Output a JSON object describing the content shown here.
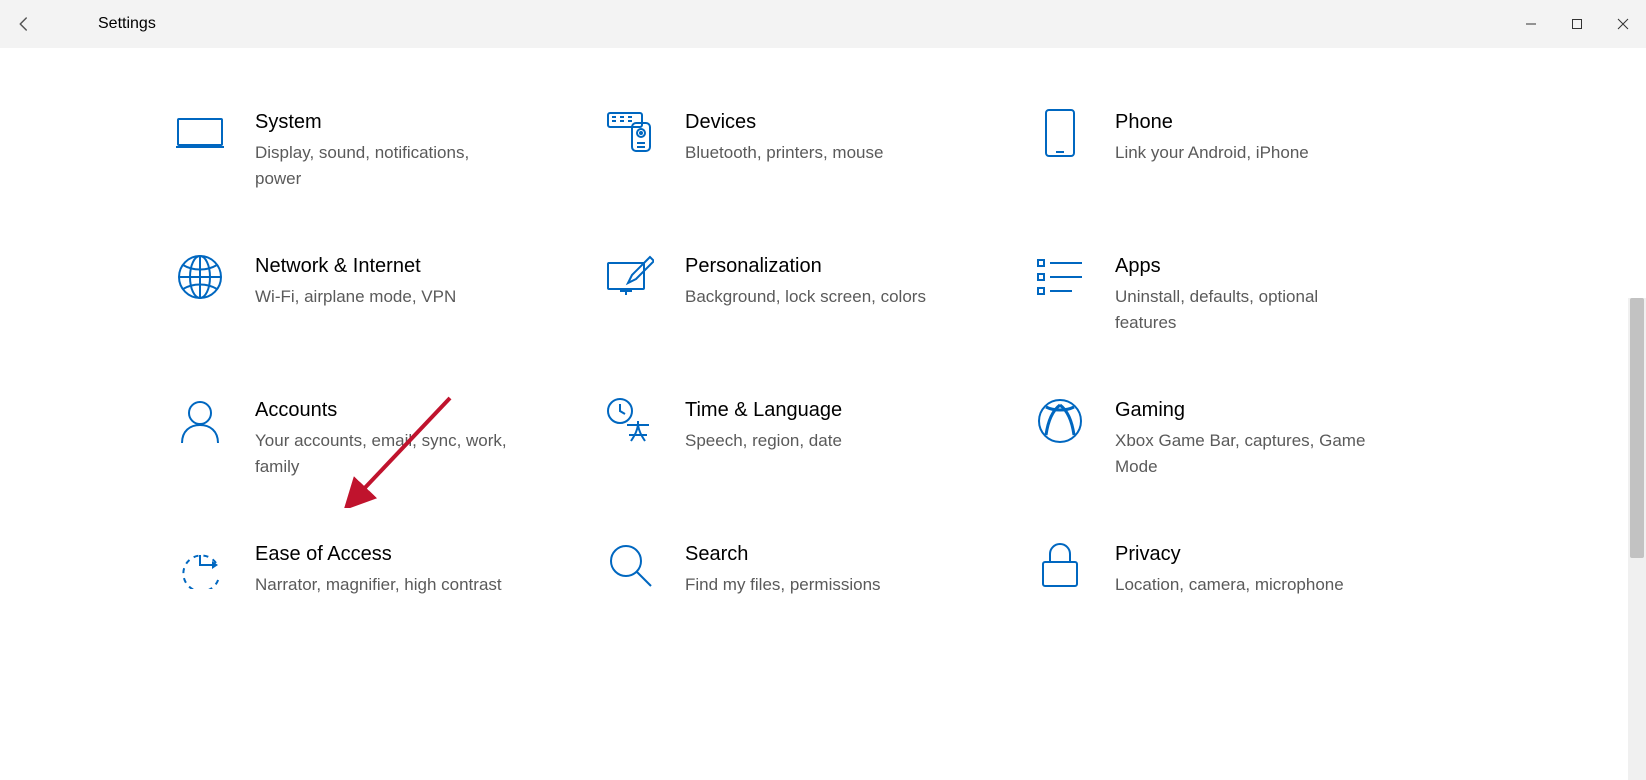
{
  "titlebar": {
    "title": "Settings"
  },
  "tiles": [
    {
      "title": "System",
      "desc": "Display, sound, notifications, power"
    },
    {
      "title": "Devices",
      "desc": "Bluetooth, printers, mouse"
    },
    {
      "title": "Phone",
      "desc": "Link your Android, iPhone"
    },
    {
      "title": "Network & Internet",
      "desc": "Wi-Fi, airplane mode, VPN"
    },
    {
      "title": "Personalization",
      "desc": "Background, lock screen, colors"
    },
    {
      "title": "Apps",
      "desc": "Uninstall, defaults, optional features"
    },
    {
      "title": "Accounts",
      "desc": "Your accounts, email, sync, work, family"
    },
    {
      "title": "Time & Language",
      "desc": "Speech, region, date"
    },
    {
      "title": "Gaming",
      "desc": "Xbox Game Bar, captures, Game Mode"
    },
    {
      "title": "Ease of Access",
      "desc": "Narrator, magnifier, high contrast"
    },
    {
      "title": "Search",
      "desc": "Find my files, permissions"
    },
    {
      "title": "Privacy",
      "desc": "Location, camera, microphone"
    }
  ],
  "colors": {
    "accent": "#0067c0",
    "annotation": "#c0132d"
  }
}
